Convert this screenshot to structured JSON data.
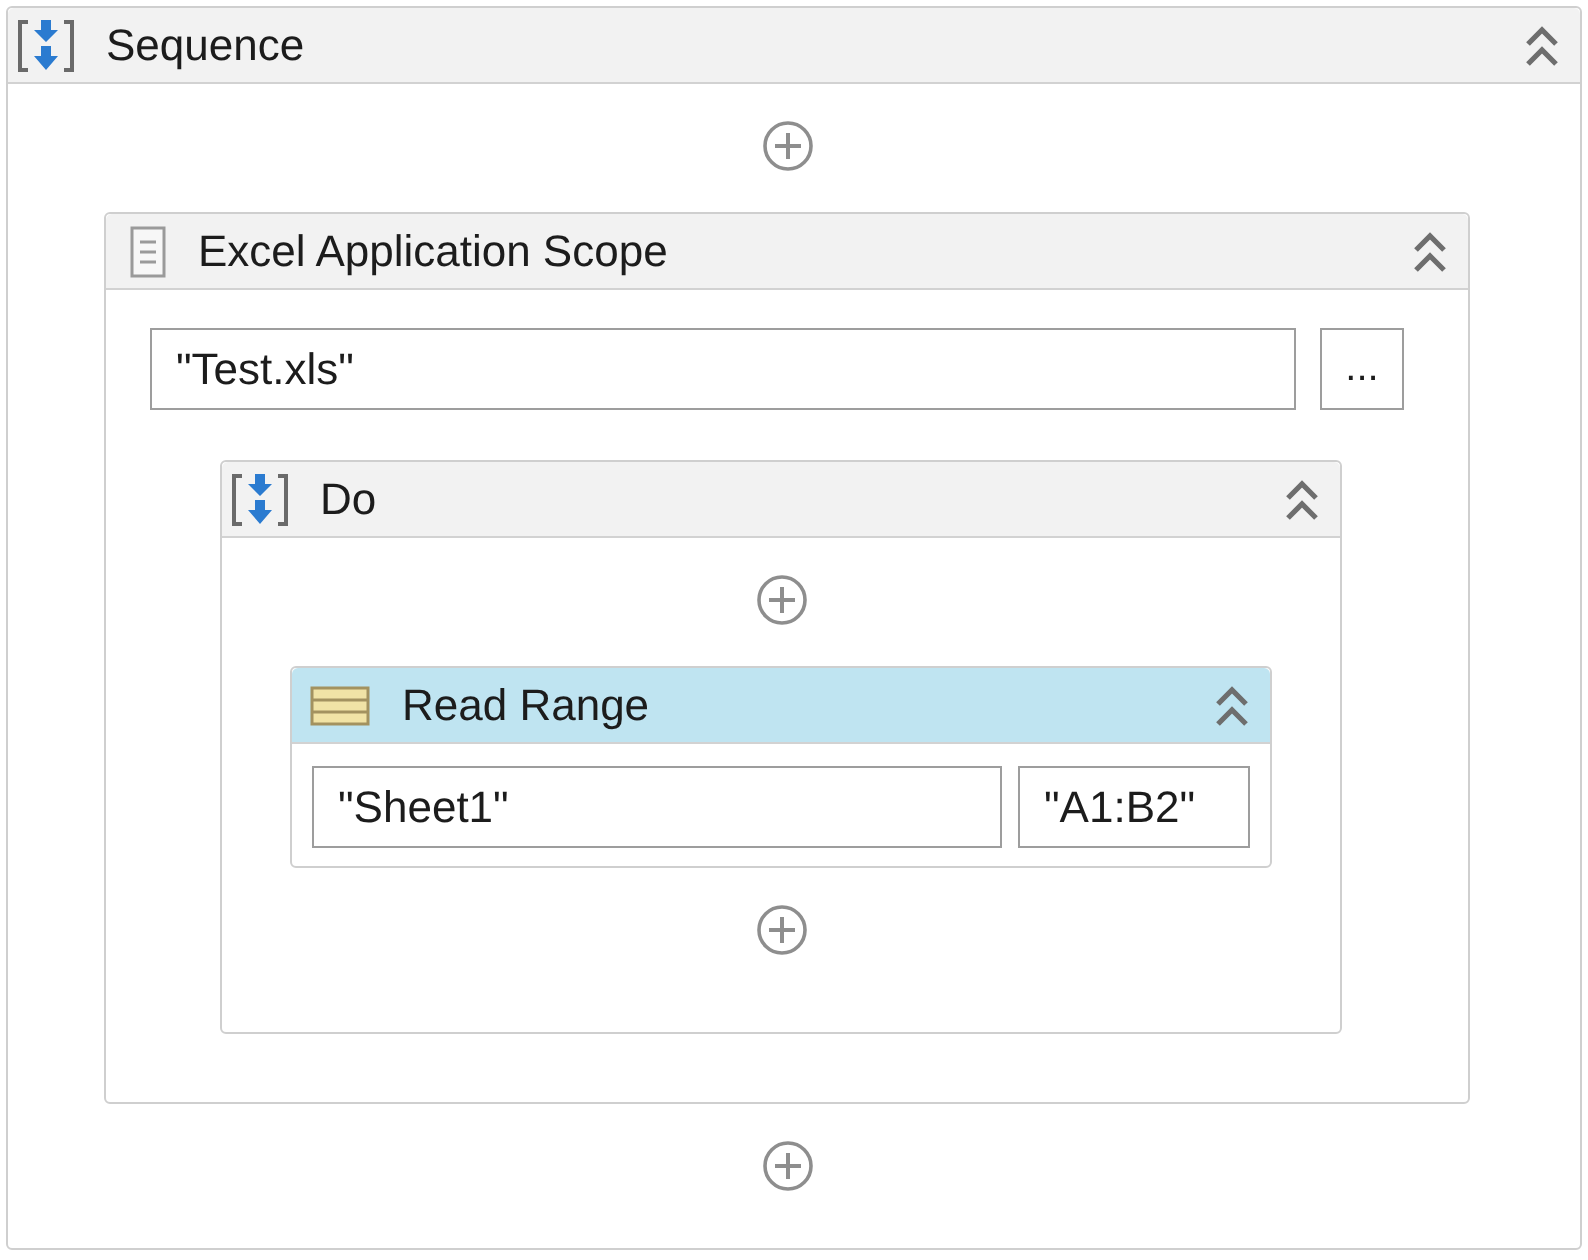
{
  "root": {
    "kind": "sequence",
    "title": "Sequence",
    "expanded": true,
    "selected": false,
    "children": [
      {
        "kind": "scope",
        "title": "Excel Application Scope",
        "expanded": true,
        "selected": false,
        "path": "\"Test.xls\"",
        "browse_label": "...",
        "children": [
          {
            "kind": "sequence",
            "title": "Do",
            "expanded": true,
            "selected": false,
            "children": [
              {
                "kind": "read_range",
                "title": "Read Range",
                "expanded": true,
                "selected": true,
                "sheet": "\"Sheet1\"",
                "range": "\"A1:B2\""
              }
            ]
          }
        ]
      }
    ]
  }
}
